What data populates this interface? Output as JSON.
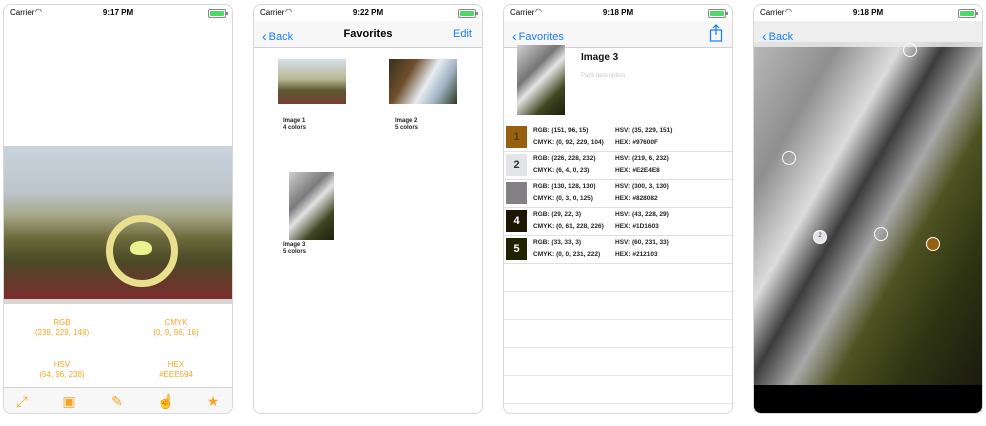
{
  "phone1": {
    "status": {
      "carrier": "Carrier",
      "time": "9:17 PM"
    },
    "rgb_label": "RGB",
    "rgb_value": "(238, 229, 148)",
    "cmyk_label": "CMYK",
    "cmyk_value": "(0, 9, 96, 16)",
    "hsv_label": "HSV",
    "hsv_value": "(54, 96, 238)",
    "hex_label": "HEX",
    "hex_value": "#EEE594",
    "tab_icons": [
      "expand-icon",
      "image-icon",
      "brush-icon",
      "thumbs-up-icon",
      "star-icon"
    ],
    "accent": "#F5A623"
  },
  "phone2": {
    "status": {
      "carrier": "Carrier",
      "time": "9:22 PM"
    },
    "back": "Back",
    "title": "Favorites",
    "edit": "Edit",
    "items": [
      {
        "name": "Image 1",
        "colors": "4 colors"
      },
      {
        "name": "Image 2",
        "colors": "5 colors"
      },
      {
        "name": "Image 3",
        "colors": "5 colors"
      }
    ]
  },
  "phone3": {
    "status": {
      "carrier": "Carrier",
      "time": "9:18 PM"
    },
    "back": "Favorites",
    "title": "Image 3",
    "description_placeholder": "Pack description",
    "colors": [
      {
        "num": "1",
        "swatch": "#97600F",
        "rgb": "RGB: (151, 96, 15)",
        "cmyk": "CMYK: (0, 92, 229, 104)",
        "hsv": "HSV: (35, 229, 151)",
        "hex": "HEX: #97600F"
      },
      {
        "num": "2",
        "swatch": "#E2E4E8",
        "rgb": "RGB: (226, 228, 232)",
        "cmyk": "CMYK: (6, 4, 0, 23)",
        "hsv": "HSV: (219, 6, 232)",
        "hex": "HEX: #E2E4E8"
      },
      {
        "num": "",
        "swatch": "#828082",
        "rgb": "RGB: (130, 128, 130)",
        "cmyk": "CMYK: (0, 3, 0, 125)",
        "hsv": "HSV: (300, 3, 130)",
        "hex": "HEX: #828082"
      },
      {
        "num": "4",
        "swatch": "#1D1603",
        "rgb": "RGB: (29, 22, 3)",
        "cmyk": "CMYK: (0, 61, 228, 226)",
        "hsv": "HSV: (43, 228, 29)",
        "hex": "HEX: #1D1603"
      },
      {
        "num": "5",
        "swatch": "#212103",
        "rgb": "RGB: (33, 33, 3)",
        "cmyk": "CMYK: (0, 0, 231, 222)",
        "hsv": "HSV: (60, 231, 33)",
        "hex": "HEX: #212103"
      }
    ]
  },
  "phone4": {
    "status": {
      "carrier": "Carrier",
      "time": "9:18 PM"
    },
    "back": "Back",
    "marker_label": "2"
  }
}
